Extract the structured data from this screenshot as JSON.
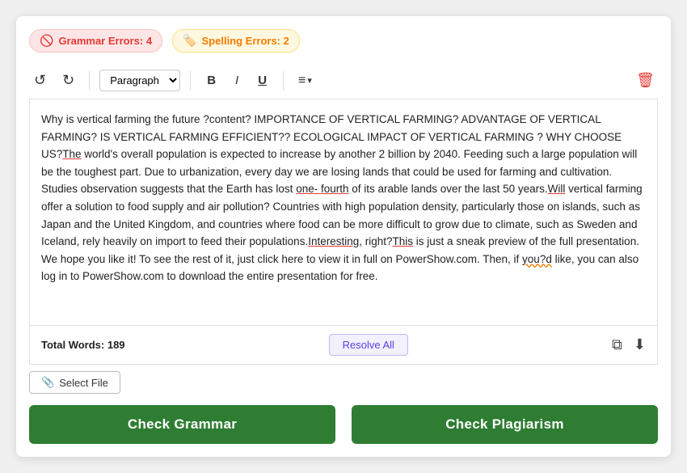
{
  "badges": {
    "grammar": {
      "label": "Grammar Errors: 4",
      "icon": "🚫"
    },
    "spelling": {
      "label": "Spelling Errors: 2",
      "icon": "🏷️"
    }
  },
  "toolbar": {
    "undo_label": "↺",
    "redo_label": "↻",
    "paragraph_default": "Paragraph",
    "bold_label": "B",
    "italic_label": "I",
    "underline_label": "U",
    "align_label": "≡",
    "align_chevron": "▾",
    "trash_label": "🗑"
  },
  "editor": {
    "content": "Why is vertical farming the future ?content? IMPORTANCE OF VERTICAL FARMING? ADVANTAGE OF VERTICAL FARMING? IS VERTICAL FARMING EFFICIENT?? ECOLOGICAL IMPACT OF VERTICAL FARMING ? WHY CHOOSE US?The world's overall population is expected to increase by another 2 billion by 2040. Feeding such a large population will be the toughest part. Due to urbanization, every day we are losing lands that could be used for farming and cultivation. Studies observation suggests that the Earth has lost one- fourth of its arable lands over the last 50 years.Will vertical farming offer a solution to food supply and air pollution? Countries with high population density, particularly those on islands, such as Japan and the United Kingdom, and countries where food can be more difficult to grow due to climate, such as Sweden and Iceland, rely heavily on import to feed their populations.Interesting, right?This is just a sneak preview of the full presentation. We hope you like it! To see the rest of it, just click here to view it in full on PowerShow.com. Then, if you?d like, you can also log in to PowerShow.com to download the entire presentation for free."
  },
  "footer": {
    "total_words_label": "Total Words: 189",
    "resolve_all_label": "Resolve All"
  },
  "file": {
    "select_label": "Select File",
    "icon": "📎"
  },
  "actions": {
    "check_grammar_label": "Check Grammar",
    "check_plagiarism_label": "Check Plagiarism"
  }
}
